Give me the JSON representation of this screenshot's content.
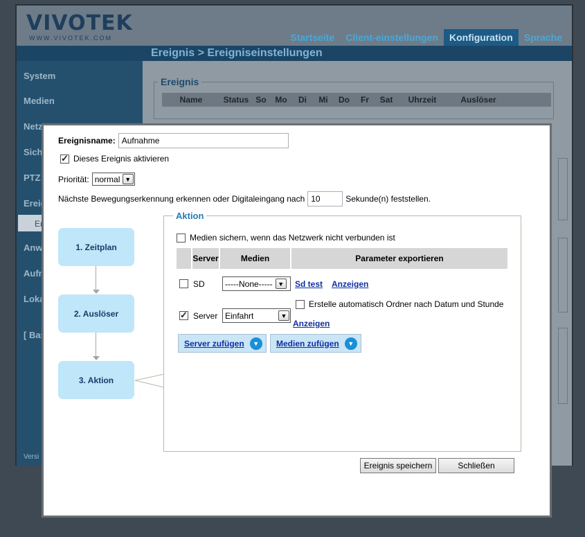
{
  "header": {
    "logo": "VIVOTEK",
    "logo_url": "WWW.VIVOTEK.COM",
    "nav": [
      "Startseite",
      "Client-einstellungen",
      "Konfiguration",
      "Sprache"
    ],
    "breadcrumb": "Ereignis  > Ereigniseinstellungen"
  },
  "sidebar": {
    "items": [
      "System",
      "Medien",
      "Netz",
      "Sich",
      "PTZ",
      "Ereig",
      "Anw",
      "Aufn",
      "Loka",
      "[ Bas"
    ],
    "subitem": "Er",
    "version": "Versi"
  },
  "background": {
    "legend": "Ereignis",
    "columns": [
      "Name",
      "Status",
      "So",
      "Mo",
      "Di",
      "Mi",
      "Do",
      "Fr",
      "Sat",
      "Uhrzeit",
      "Auslöser"
    ]
  },
  "form": {
    "name_label": "Ereignisname:",
    "name_value": "Aufnahme",
    "enable_label": "Dieses Ereignis aktivieren",
    "enable_checked": true,
    "priority_label": "Priorität:",
    "priority_value": "normal",
    "delay_prefix": "Nächste Bewegungserkennung erkennen oder Digitaleingang nach",
    "delay_value": "10",
    "delay_suffix": "Sekunde(n) feststellen."
  },
  "steps": [
    "1.  Zeitplan",
    "2.  Auslöser",
    "3.  Aktion"
  ],
  "aktion": {
    "legend": "Aktion",
    "backup_label": "Medien sichern, wenn das Netzwerk nicht verbunden ist",
    "backup_checked": false,
    "headers": [
      "Server",
      "Medien",
      "Parameter exportieren"
    ],
    "rows": [
      {
        "name": "SD",
        "checked": false,
        "media": "-----None-----",
        "links": [
          "Sd test",
          "Anzeigen"
        ]
      },
      {
        "name": "Server",
        "checked": true,
        "media": "Einfahrt",
        "folder_label": "Erstelle automatisch Ordner nach Datum und Stunde",
        "folder_checked": false,
        "link": "Anzeigen"
      }
    ],
    "add_server": "Server zufügen",
    "add_media": "Medien zufügen"
  },
  "buttons": {
    "save": "Ereignis speichern",
    "close": "Schließen"
  },
  "icons": {
    "dropdown": "chevron-down-icon",
    "add": "chevron-down-circle-icon",
    "check": "checkmark-icon"
  },
  "colors": {
    "step_bg": "#bfe6f9",
    "legend": "#2579b8",
    "link": "#0f2fa3",
    "add_button_bg": "#c9e5f6"
  }
}
